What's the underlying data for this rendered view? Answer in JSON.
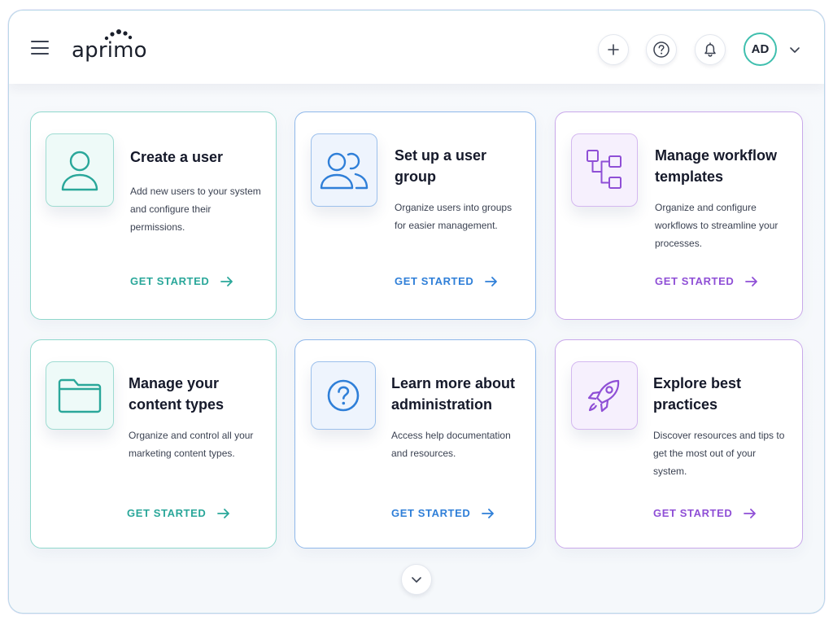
{
  "header": {
    "logo_text": "aprimo",
    "avatar_initials": "AD",
    "icons": [
      "menu-icon",
      "plus-icon",
      "help-icon",
      "bell-icon",
      "chevron-down-icon"
    ]
  },
  "colors": {
    "teal": "#2aa79a",
    "blue": "#2f7fd8",
    "purple": "#8f4fd6",
    "avatar_ring": "#3fbfae"
  },
  "cards": [
    {
      "title": "Create a user",
      "description": "Add new users to your system and configure their permissions.",
      "cta": "GET STARTED",
      "icon": "user-icon",
      "theme": "teal"
    },
    {
      "title": "Set up a user group",
      "description": "Organize users into groups for easier management.",
      "cta": "GET STARTED",
      "icon": "user-group-icon",
      "theme": "blue"
    },
    {
      "title": "Manage workflow templates",
      "description": "Organize and configure workflows to streamline your processes.",
      "cta": "GET STARTED",
      "icon": "workflow-icon",
      "theme": "purple"
    },
    {
      "title": "Manage your content types",
      "description": "Organize and control all your marketing content types.",
      "cta": "GET STARTED",
      "icon": "folder-icon",
      "theme": "teal"
    },
    {
      "title": "Learn more about administration",
      "description": "Access help documentation and resources.",
      "cta": "GET STARTED",
      "icon": "question-icon",
      "theme": "blue"
    },
    {
      "title": "Explore best practices",
      "description": "Discover resources and tips to get the most out of your system.",
      "cta": "GET STARTED",
      "icon": "rocket-icon",
      "theme": "purple"
    }
  ]
}
